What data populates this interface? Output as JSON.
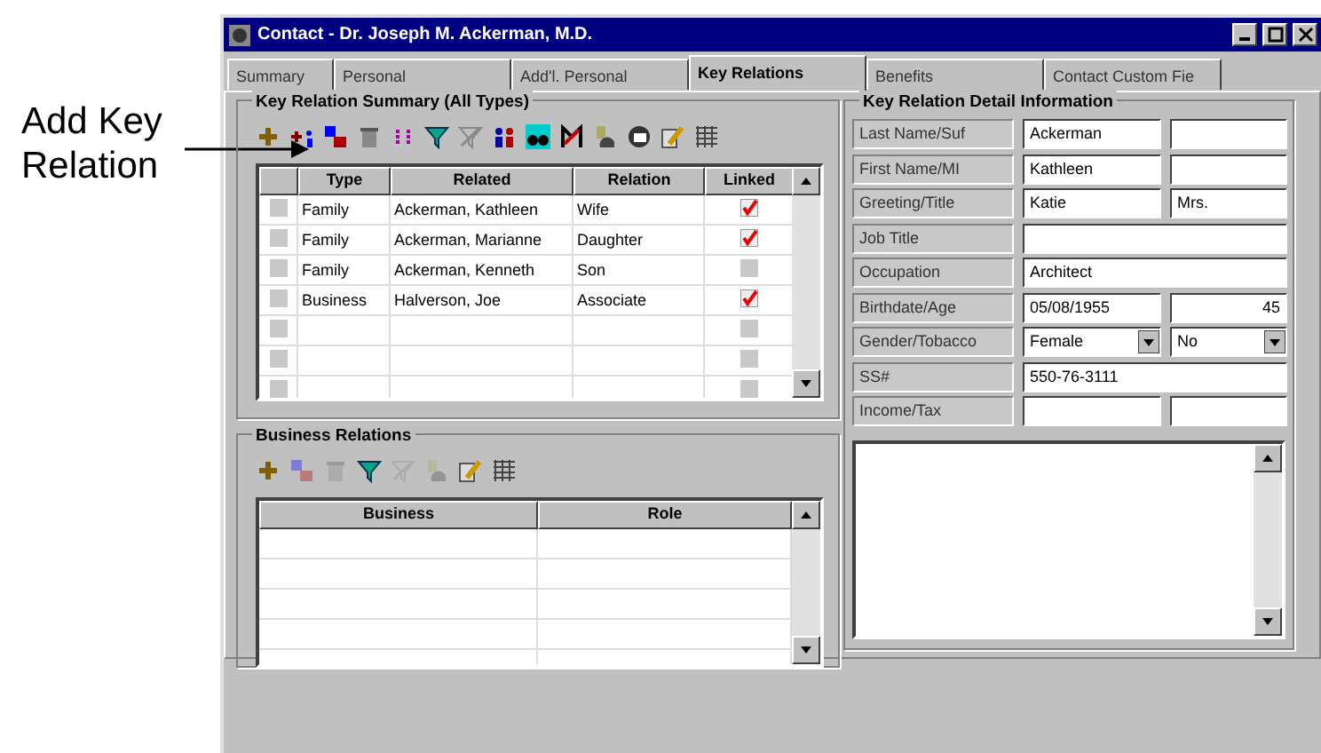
{
  "annotation": {
    "text": "Add Key Relation"
  },
  "window": {
    "title": "Contact - Dr. Joseph M. Ackerman, M.D."
  },
  "tabs": [
    {
      "label": "Summary",
      "selected": false
    },
    {
      "label": "Personal",
      "selected": false
    },
    {
      "label": "Add'l. Personal",
      "selected": false
    },
    {
      "label": "Key Relations",
      "selected": true
    },
    {
      "label": "Benefits",
      "selected": false
    },
    {
      "label": "Contact Custom Fie",
      "selected": false
    }
  ],
  "summary": {
    "title": "Key Relation Summary (All Types)",
    "toolbar": [
      {
        "kind": "add",
        "disabled": false
      },
      {
        "kind": "add-link",
        "disabled": false
      },
      {
        "kind": "link",
        "disabled": false
      },
      {
        "kind": "delete",
        "disabled": false
      },
      {
        "kind": "sort",
        "disabled": false
      },
      {
        "kind": "filter",
        "disabled": false
      },
      {
        "kind": "clear-filter",
        "disabled": false
      },
      {
        "kind": "group",
        "disabled": false
      },
      {
        "kind": "find",
        "disabled": false
      },
      {
        "kind": "map",
        "disabled": false
      },
      {
        "kind": "note",
        "disabled": false
      },
      {
        "kind": "email",
        "disabled": false
      },
      {
        "kind": "edit",
        "disabled": false
      },
      {
        "kind": "grid",
        "disabled": false
      }
    ],
    "columns": [
      "Type",
      "Related",
      "Relation",
      "Linked"
    ],
    "rows": [
      {
        "type": "Family",
        "related": "Ackerman, Kathleen",
        "relation": "Wife",
        "linked": true
      },
      {
        "type": "Family",
        "related": "Ackerman, Marianne",
        "relation": "Daughter",
        "linked": true
      },
      {
        "type": "Family",
        "related": "Ackerman, Kenneth",
        "relation": "Son",
        "linked": false
      },
      {
        "type": "Business",
        "related": "Halverson, Joe",
        "relation": "Associate",
        "linked": true
      },
      {
        "linked": false
      },
      {
        "linked": false
      },
      {
        "linked": false
      }
    ]
  },
  "business": {
    "title": "Business Relations",
    "toolbar": [
      {
        "kind": "add",
        "disabled": false
      },
      {
        "kind": "link",
        "disabled": true
      },
      {
        "kind": "delete",
        "disabled": true
      },
      {
        "kind": "filter",
        "disabled": false
      },
      {
        "kind": "clear-filter",
        "disabled": true
      },
      {
        "kind": "note",
        "disabled": true
      },
      {
        "kind": "edit",
        "disabled": false
      },
      {
        "kind": "grid",
        "disabled": false
      }
    ],
    "columns": [
      "Business",
      "Role"
    ]
  },
  "detail": {
    "title": "Key Relation Detail Information",
    "fields": [
      {
        "label": "Last Name/Suf",
        "kind": "pair",
        "value": "Ackerman"
      },
      {
        "label": "First Name/MI",
        "kind": "pair",
        "value": "Kathleen"
      },
      {
        "label": "Greeting/Title",
        "kind": "pair",
        "value": "Katie",
        "value2": "Mrs."
      },
      {
        "label": "Job Title",
        "kind": "single"
      },
      {
        "label": "Occupation",
        "kind": "single",
        "value": "Architect"
      },
      {
        "label": "Birthdate/Age",
        "kind": "pair",
        "value": "05/08/1955",
        "value2": "45"
      },
      {
        "label": "Gender/Tobacco",
        "kind": "selects",
        "value": "Female",
        "value2": "No"
      },
      {
        "label": "SS#",
        "kind": "single",
        "value": "550-76-3111"
      },
      {
        "label": "Income/Tax",
        "kind": "pair"
      }
    ]
  }
}
